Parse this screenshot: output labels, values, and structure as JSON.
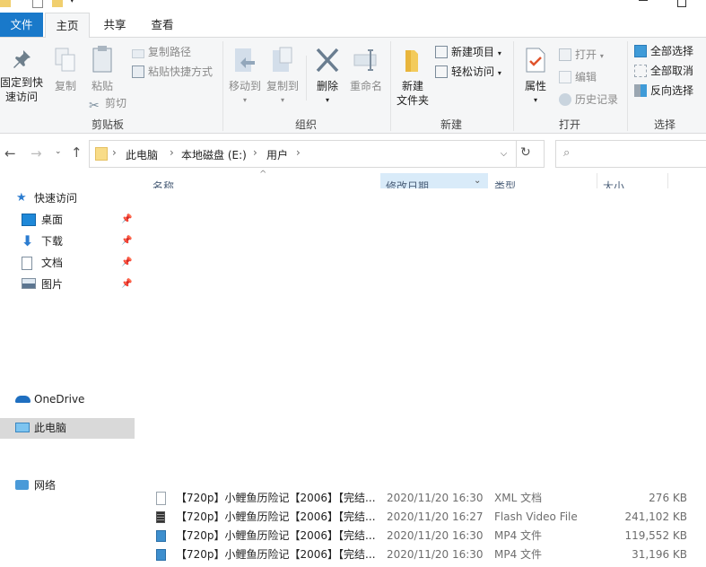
{
  "ribbon_tabs": [
    {
      "label": "文件"
    },
    {
      "label": "主页"
    },
    {
      "label": "共享"
    },
    {
      "label": "查看"
    }
  ],
  "clipboard": {
    "pin": "固定到快\n速访问",
    "pin1": "固定到快",
    "pin2": "速访问",
    "copy": "复制",
    "paste": "粘贴",
    "copy_path": "复制路径",
    "paste_shortcut": "粘贴快捷方式",
    "cut": "剪切",
    "label": "剪贴板"
  },
  "organize": {
    "move_to": "移动到",
    "copy_to": "复制到",
    "delete": "删除",
    "rename": "重命名",
    "label": "组织"
  },
  "new": {
    "new_folder1": "新建",
    "new_folder2": "文件夹",
    "new_item": "新建项目",
    "easy_access": "轻松访问",
    "label": "新建"
  },
  "open": {
    "properties": "属性",
    "open": "打开",
    "edit": "编辑",
    "history": "历史记录",
    "label": "打开"
  },
  "select": {
    "select_all": "全部选择",
    "select_none": "全部取消",
    "invert": "反向选择",
    "label": "选择"
  },
  "address": {
    "crumbs": [
      "此电脑",
      "本地磁盘 (E:)",
      "用户"
    ]
  },
  "nav": {
    "quick_access": "快速访问",
    "desktop": "桌面",
    "downloads": "下载",
    "documents": "文档",
    "pictures": "图片",
    "onedrive": "OneDrive",
    "this_pc": "此电脑",
    "network": "网络"
  },
  "columns": {
    "name": "名称",
    "date": "修改日期",
    "type": "类型",
    "size": "大小"
  },
  "files": [
    {
      "name": "【720p】小鲤鱼历险记【2006】【完结...",
      "date": "2020/11/20 16:30",
      "type": "XML 文档",
      "size": "276 KB",
      "icon": "xml-file-icon"
    },
    {
      "name": "【720p】小鲤鱼历险记【2006】【完结...",
      "date": "2020/11/20 16:27",
      "type": "Flash Video File",
      "size": "241,102 KB",
      "icon": "flv-file-icon"
    },
    {
      "name": "【720p】小鲤鱼历险记【2006】【完结...",
      "date": "2020/11/20 16:30",
      "type": "MP4 文件",
      "size": "119,552 KB",
      "icon": "mp4-file-icon"
    },
    {
      "name": "【720p】小鲤鱼历险记【2006】【完结...",
      "date": "2020/11/20 16:30",
      "type": "MP4 文件",
      "size": "31,196 KB",
      "icon": "mp4-file-icon"
    }
  ],
  "colors": {
    "file_tab": "#1979ca",
    "selected_nav": "#d9d9d9",
    "date_header": "#d9ebf9"
  }
}
